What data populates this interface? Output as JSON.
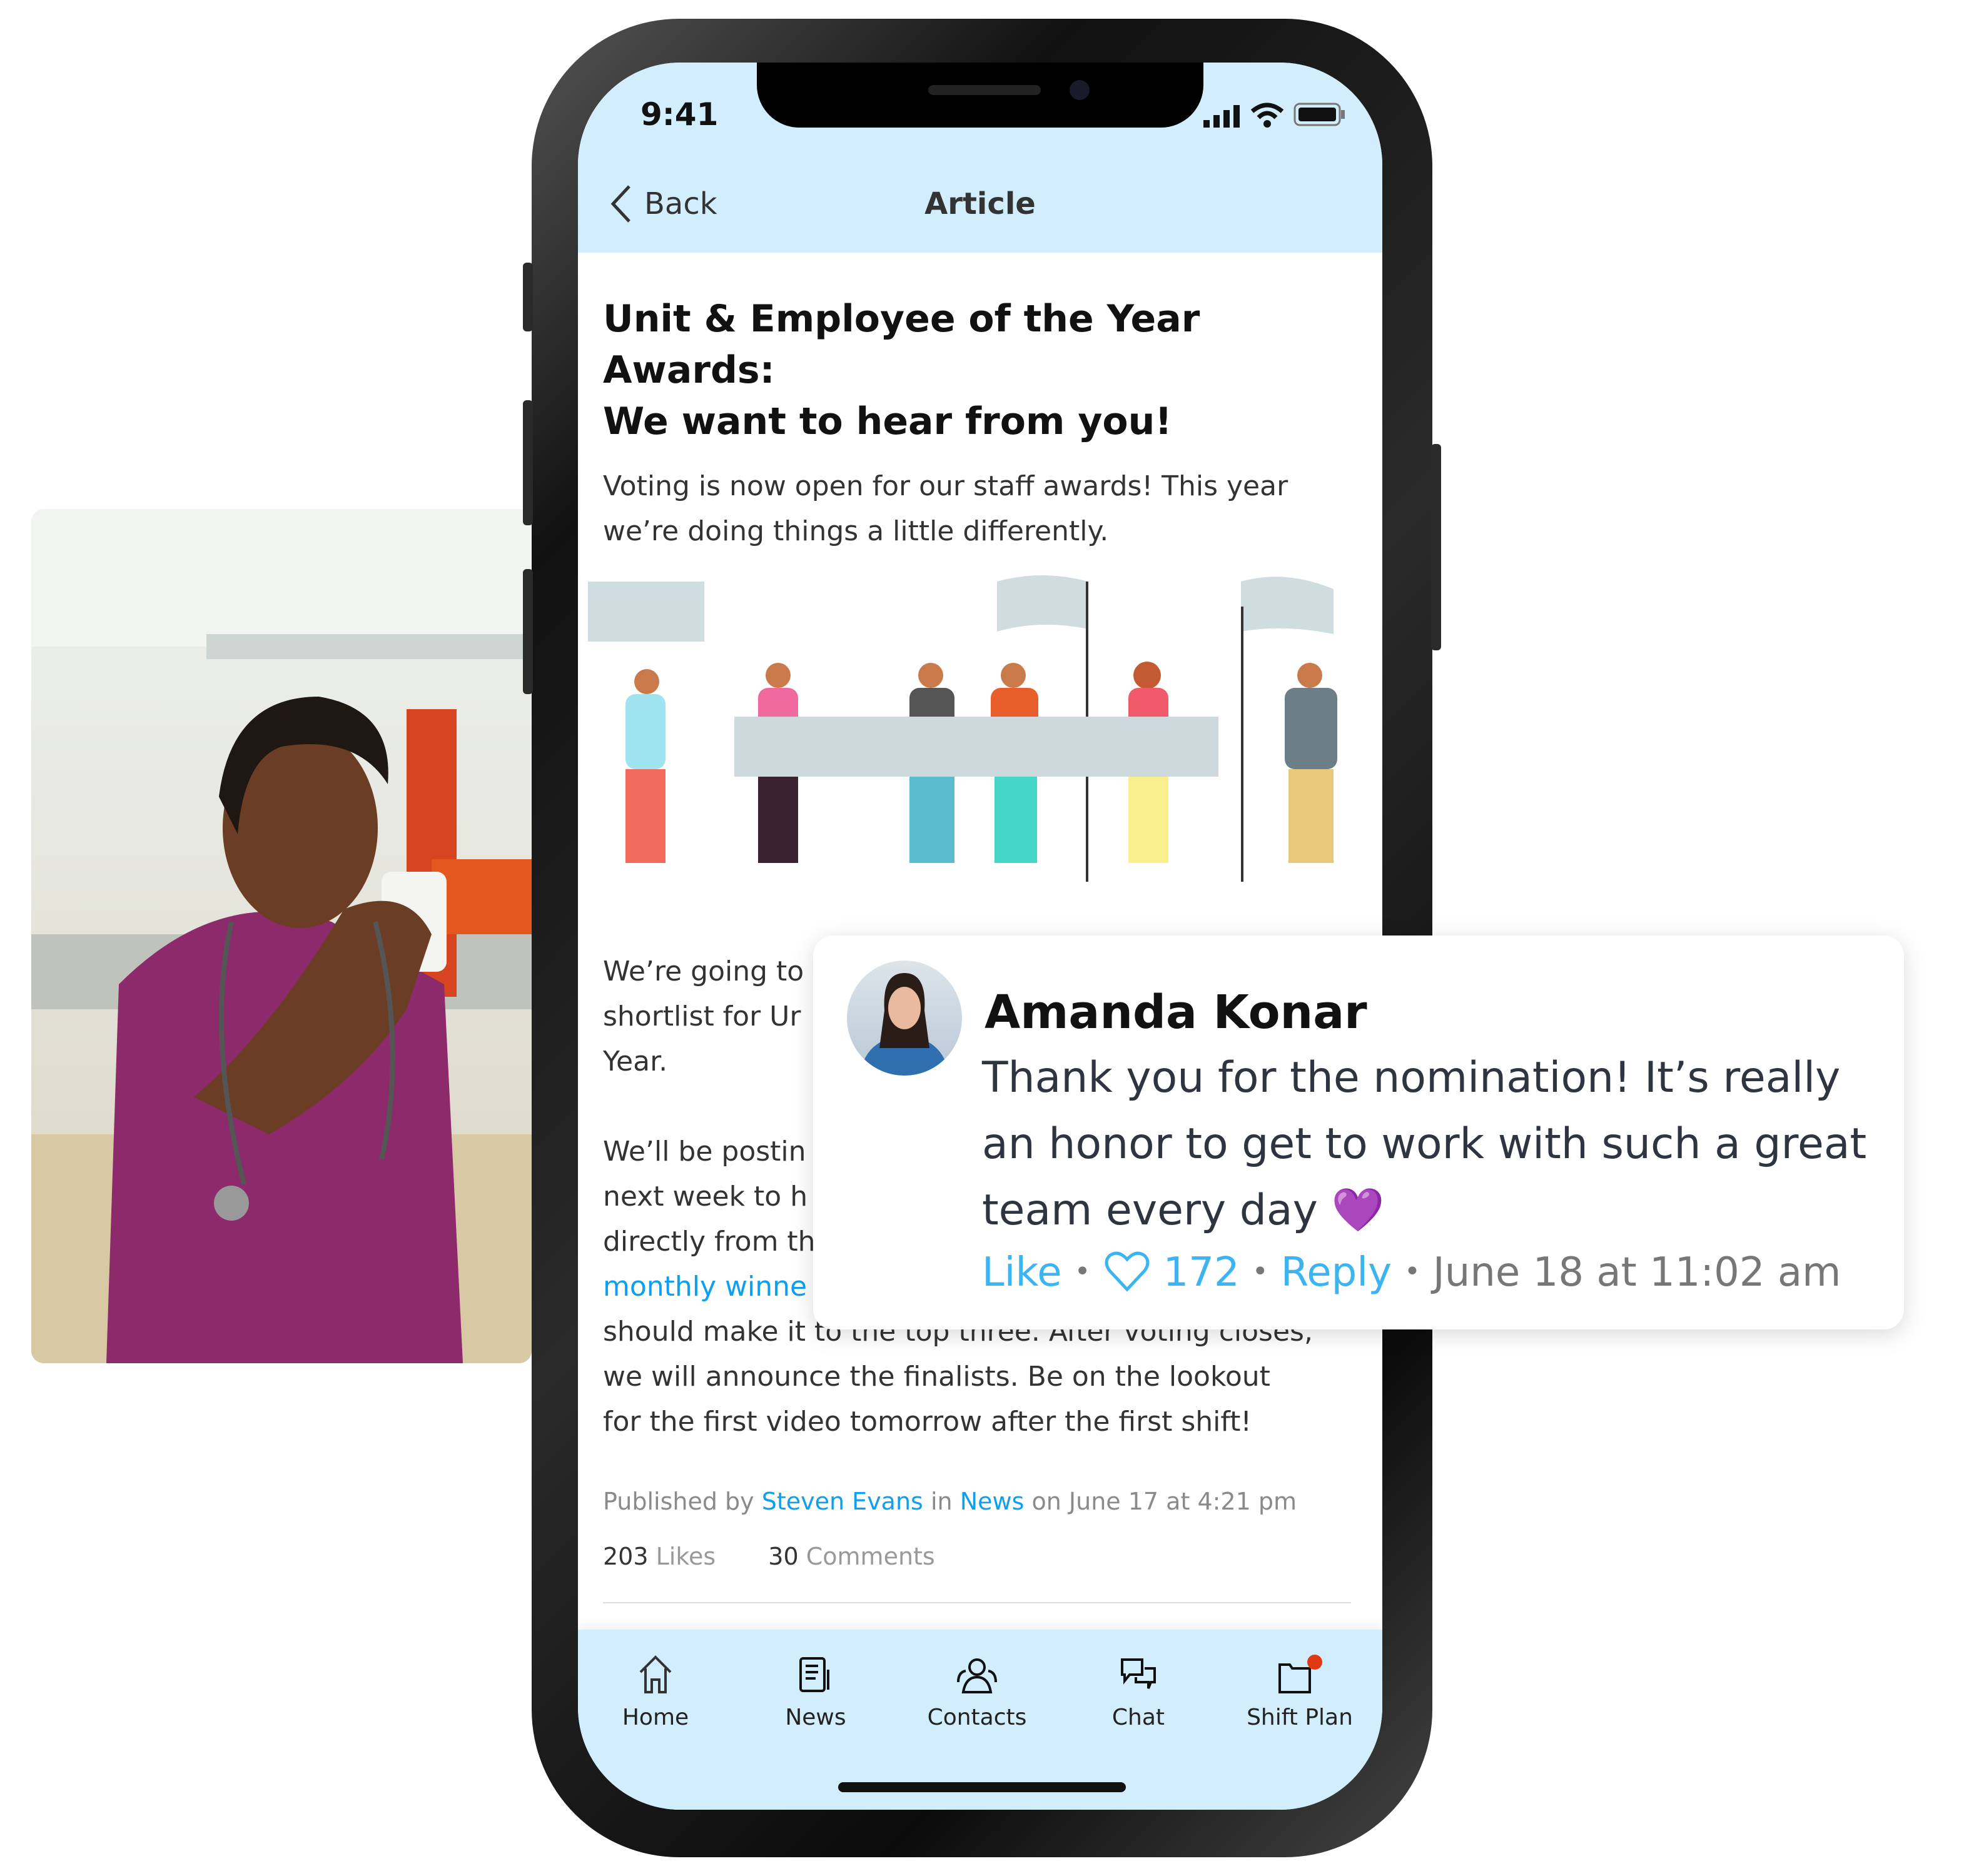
{
  "status_bar": {
    "time": "9:41"
  },
  "header": {
    "back_label": "Back",
    "title": "Article"
  },
  "article": {
    "title_line1": "Unit & Employee of the Year Awards:",
    "title_line2": "We want to hear from you!",
    "lead_line1": "Voting is now open for our staff awards! This year",
    "lead_line2": "we’re doing things a little differently.",
    "para1": [
      "We’re going to",
      "shortlist for Ur",
      "Year."
    ],
    "para2": [
      "We’ll be postin",
      "next week to h",
      "directly from th"
    ],
    "para2_link": "monthly winne",
    "para3": [
      "should make it to the top three. After voting closes,",
      "we will announce the finalists. Be on the lookout",
      "for the first video tomorrow after the first shift!"
    ],
    "meta": {
      "prefix": "Published by",
      "author": "Steven Evans",
      "in": "in",
      "category": "News",
      "suffix": "on June 17 at 4:21 pm"
    },
    "likes_count": "203",
    "likes_label": "Likes",
    "comments_count": "30",
    "comments_label": "Comments"
  },
  "nav": [
    {
      "label": "Home",
      "icon": "home-icon"
    },
    {
      "label": "News",
      "icon": "newspaper-icon"
    },
    {
      "label": "Contacts",
      "icon": "contacts-icon"
    },
    {
      "label": "Chat",
      "icon": "chat-icon"
    },
    {
      "label": "Shift Plan",
      "icon": "folder-icon",
      "badge": true
    }
  ],
  "comment": {
    "author": "Amanda Konar",
    "text": "Thank you for the nomination! It’s really an honor to get to work with such a great team every day",
    "emoji": "💜",
    "like_label": "Like",
    "like_count": "172",
    "reply_label": "Reply",
    "timestamp": "June 18 at 11:02 am",
    "separator": "•"
  },
  "colors": {
    "accent": "#0ea0ee",
    "header_bg": "#d2eefd",
    "badge": "#e03a12",
    "heart": "#a040e8"
  }
}
